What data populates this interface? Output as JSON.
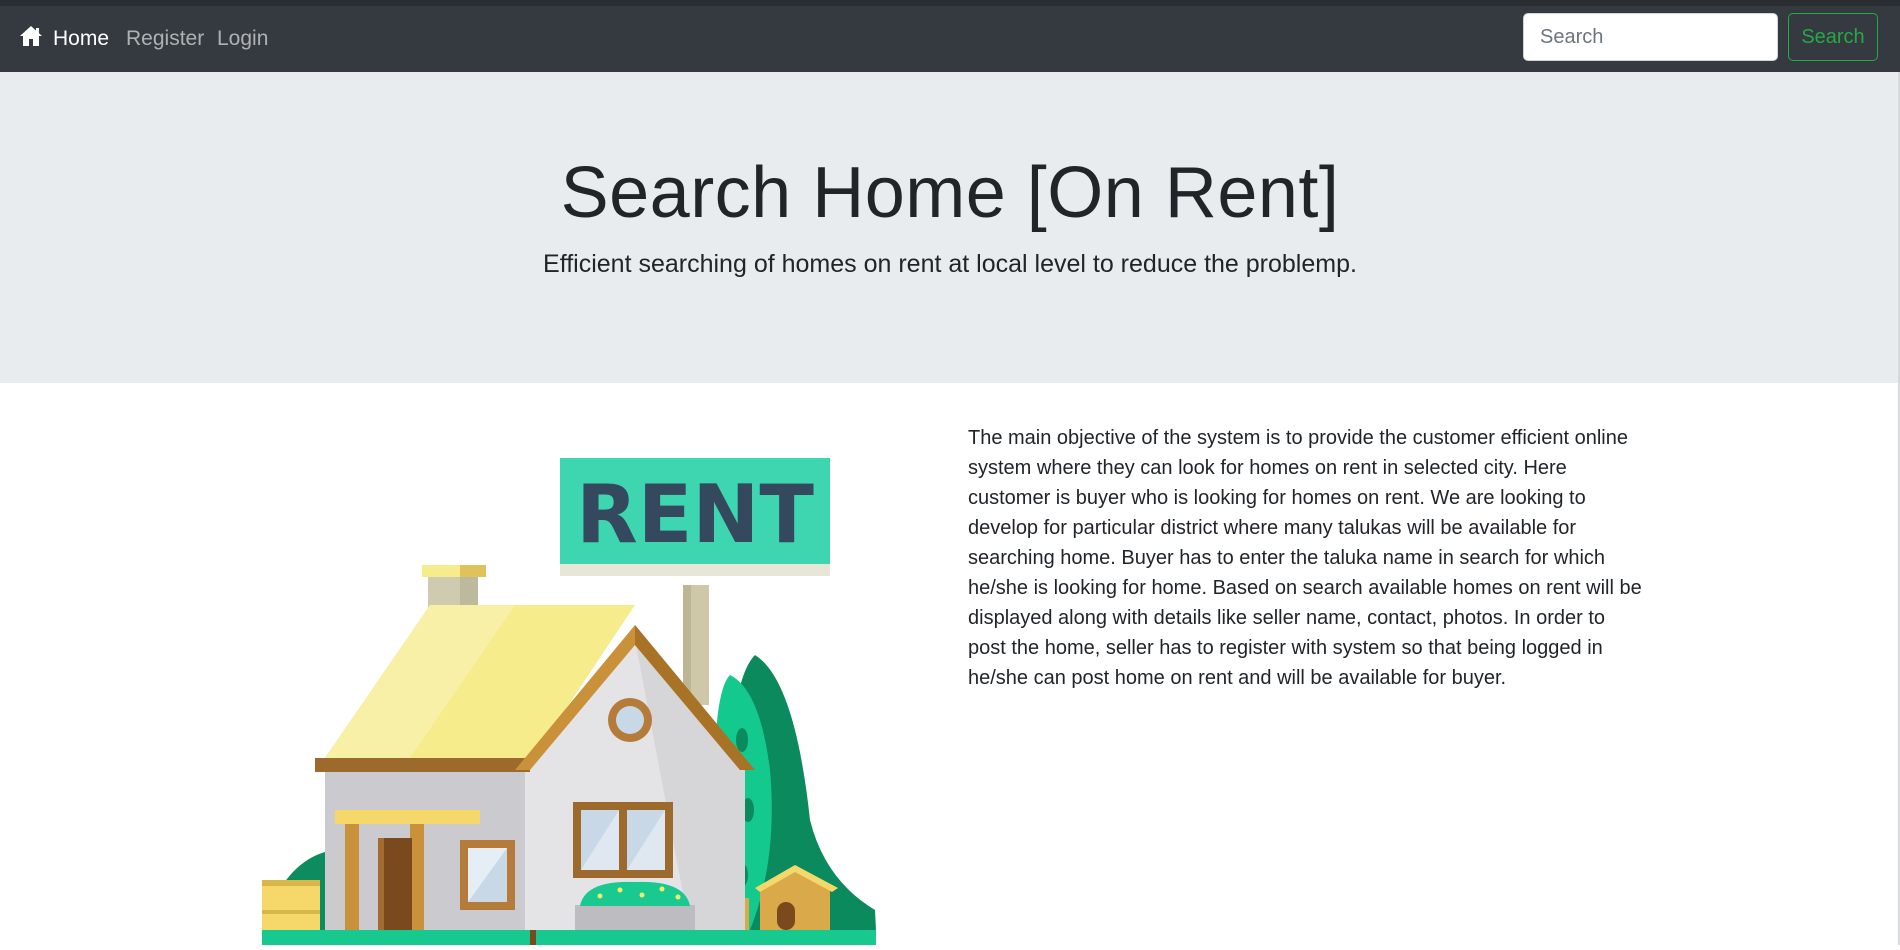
{
  "navbar": {
    "brand_label": "Home",
    "links": [
      {
        "label": "Register"
      },
      {
        "label": "Login"
      }
    ],
    "search": {
      "placeholder": "Search",
      "value": "",
      "button_label": "Search"
    }
  },
  "jumbotron": {
    "title": "Search Home [On Rent]",
    "lead": "Efficient searching of homes on rent at local level to reduce the problemp."
  },
  "illustration": {
    "sign_text": "RENT"
  },
  "description": "The main objective of the system is to provide the customer efficient online system where they can look for homes on rent in selected city. Here customer is buyer who is looking for homes on rent. We are looking to develop for particular district where many talukas will be available for searching home. Buyer has to enter the taluka name in search for which he/she is looking for home. Based on search available homes on rent will be displayed along with details like seller name, contact, photos. In order to post the home, seller has to register with system so that being logged in he/she can post home on rent and will be available for buyer.",
  "colors": {
    "navbar_bg": "#343a40",
    "jumbotron_bg": "#e9ecef",
    "success": "#28a745",
    "sign_green": "#3dd6b0",
    "roof_yellow": "#f7ec8b",
    "tree_green": "#0a8a5c"
  },
  "icons": {
    "brand": "home-icon"
  }
}
